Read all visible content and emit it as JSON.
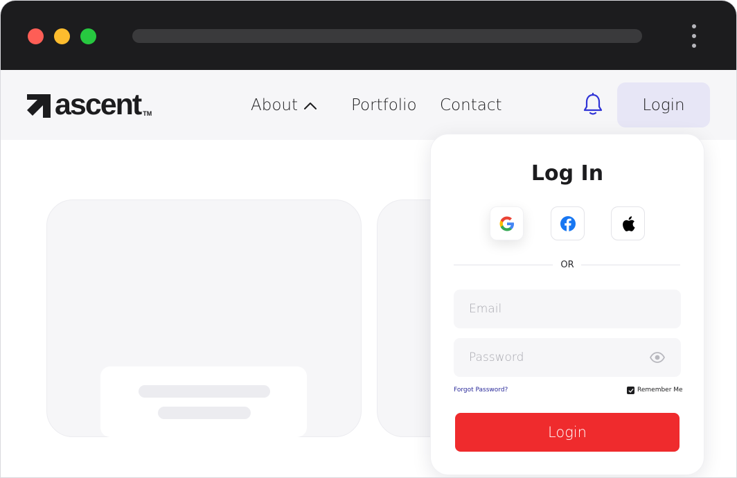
{
  "window": {
    "controls": [
      "close",
      "minimize",
      "maximize"
    ],
    "menu_icon": "kebab-menu-icon"
  },
  "brand": {
    "name": "ascent",
    "trademark": "TM",
    "mark_icon": "arrow-up-right-icon"
  },
  "nav": {
    "items": [
      {
        "label": "About",
        "icon": "chevron-up-icon",
        "expanded": true
      },
      {
        "label": "Portfolio"
      },
      {
        "label": "Contact"
      }
    ],
    "notification_icon": "bell-icon",
    "login_label": "Login"
  },
  "login_panel": {
    "title": "Log In",
    "social": [
      {
        "provider": "Google",
        "icon": "google-icon"
      },
      {
        "provider": "Facebook",
        "icon": "facebook-icon"
      },
      {
        "provider": "Apple",
        "icon": "apple-icon"
      }
    ],
    "divider_text": "OR",
    "email": {
      "placeholder": "Email",
      "value": ""
    },
    "password": {
      "placeholder": "Password",
      "value": "",
      "toggle_icon": "eye-icon"
    },
    "forgot_label": "Forgot Password?",
    "remember_label": "Remember Me",
    "remember_checked": true,
    "submit_label": "Login"
  },
  "colors": {
    "titlebar": "#1c1c1e",
    "accent_red": "#ef2b2d",
    "login_button_bg": "#e7e6f6",
    "link_blue": "#2a2a9a",
    "bell_blue": "#2f33d6",
    "close_red": "#fe5e56",
    "minimize_yellow": "#fdbc2e",
    "maximize_green": "#27c840"
  }
}
